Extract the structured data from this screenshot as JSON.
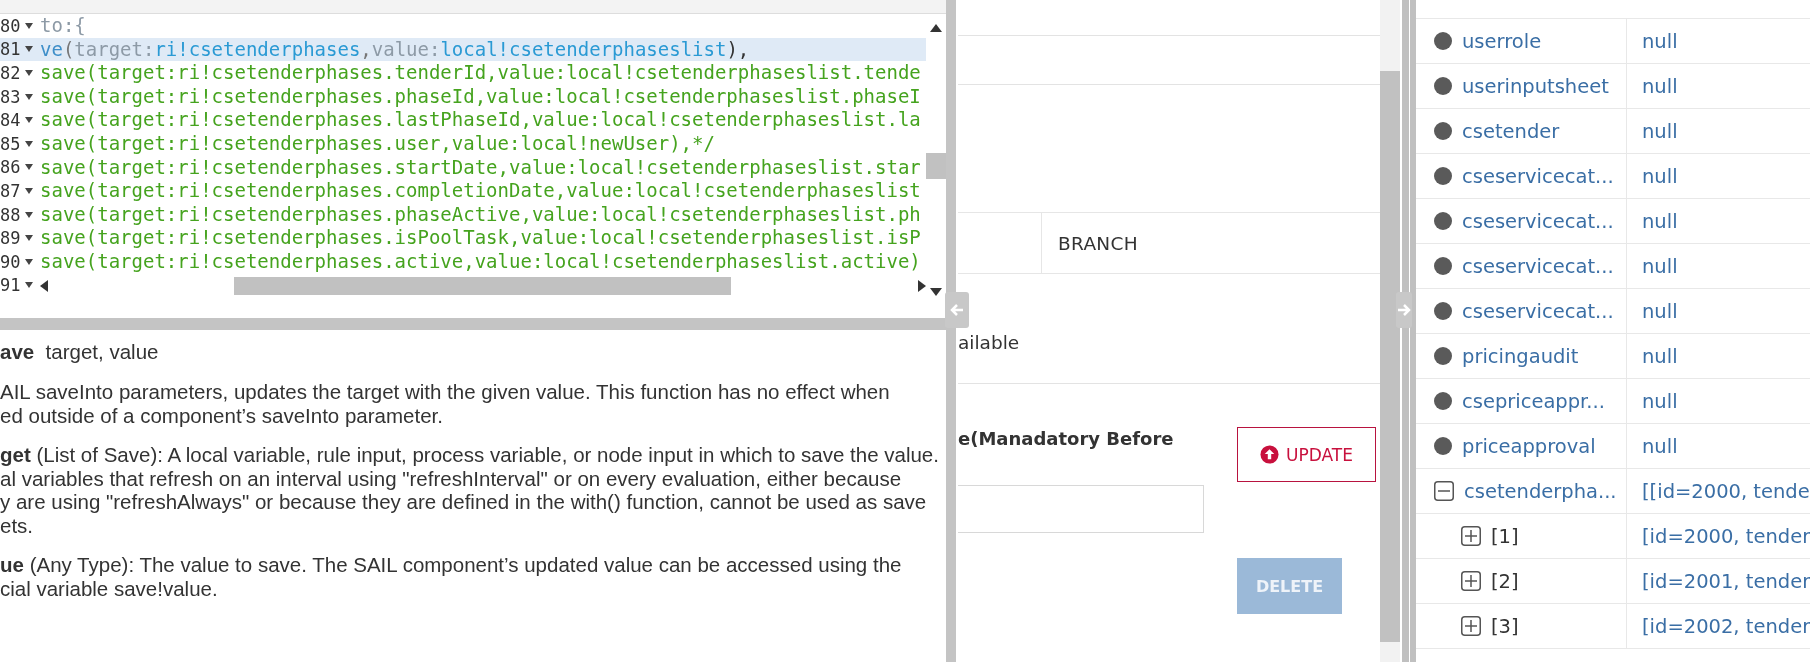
{
  "code_editor": {
    "lines": [
      {
        "number": "80",
        "active": false,
        "tokens": [
          {
            "kind": "keyword",
            "text": "to:{"
          }
        ]
      },
      {
        "number": "81",
        "active": true,
        "tokens": [
          {
            "kind": "func",
            "text": "ve"
          },
          {
            "kind": "punct",
            "text": "("
          },
          {
            "kind": "keyword",
            "text": "target:"
          },
          {
            "kind": "name",
            "text": "ri!csetenderphases"
          },
          {
            "kind": "punct",
            "text": ","
          },
          {
            "kind": "keyword",
            "text": "value:"
          },
          {
            "kind": "name",
            "text": "local!csetenderphaseslist"
          },
          {
            "kind": "plain",
            "text": "),"
          }
        ]
      },
      {
        "number": "82",
        "active": false,
        "tokens": [
          {
            "kind": "comment",
            "text": "save(target:ri!csetenderphases.tenderId,value:local!csetenderphaseslist.tende"
          }
        ]
      },
      {
        "number": "83",
        "active": false,
        "tokens": [
          {
            "kind": "comment",
            "text": "save(target:ri!csetenderphases.phaseId,value:local!csetenderphaseslist.phaseI"
          }
        ]
      },
      {
        "number": "84",
        "active": false,
        "tokens": [
          {
            "kind": "comment",
            "text": "save(target:ri!csetenderphases.lastPhaseId,value:local!csetenderphaseslist.la"
          }
        ]
      },
      {
        "number": "85",
        "active": false,
        "tokens": [
          {
            "kind": "comment",
            "text": "save(target:ri!csetenderphases.user,value:local!newUser),*/"
          }
        ]
      },
      {
        "number": "86",
        "active": false,
        "tokens": [
          {
            "kind": "comment",
            "text": "save(target:ri!csetenderphases.startDate,value:local!csetenderphaseslist.star"
          }
        ]
      },
      {
        "number": "87",
        "active": false,
        "tokens": [
          {
            "kind": "comment",
            "text": "save(target:ri!csetenderphases.completionDate,value:local!csetenderphaseslist"
          }
        ]
      },
      {
        "number": "88",
        "active": false,
        "tokens": [
          {
            "kind": "comment",
            "text": "save(target:ri!csetenderphases.phaseActive,value:local!csetenderphaseslist.ph"
          }
        ]
      },
      {
        "number": "89",
        "active": false,
        "tokens": [
          {
            "kind": "comment",
            "text": "save(target:ri!csetenderphases.isPoolTask,value:local!csetenderphaseslist.isP"
          }
        ]
      },
      {
        "number": "90",
        "active": false,
        "tokens": [
          {
            "kind": "comment",
            "text": "save(target:ri!csetenderphases.active,value:local!csetenderphaseslist.active)"
          }
        ]
      },
      {
        "number": "91",
        "active": false
      }
    ]
  },
  "help": {
    "signature": "**ave**  target, value",
    "paragraphs": [
      {
        "lines": [
          "AIL saveInto parameters, updates the target with the given value. This function has no effect when",
          "ed outside of a component’s saveInto parameter."
        ]
      },
      {
        "lines": [
          "**get** (List of Save): A local variable, rule input, process variable, or node input in which to save the value.",
          "al variables that refresh on an interval using \"refreshInterval\" or on every evaluation, either because",
          "y are using \"refreshAlways\" or because they are defined in the with() function, cannot be used as save",
          "ets."
        ]
      },
      {
        "lines": [
          "**ue** (Any Type): The value to save. The SAIL component’s updated value can be accessed using the",
          "cial variable save!value."
        ]
      }
    ]
  },
  "form": {
    "cell_value": "BRANCH",
    "availability_text": "ailable",
    "field_label": "e(Manadatory Before",
    "update_button": "UPDATE",
    "delete_button": {
      "label": "DELETE",
      "disabled": true
    }
  },
  "variables": [
    {
      "kind": "leaf",
      "name": "userrole",
      "value": "null"
    },
    {
      "kind": "leaf",
      "name": "userinputsheet",
      "value": "null"
    },
    {
      "kind": "leaf",
      "name": "csetender",
      "value": "null"
    },
    {
      "kind": "leaf",
      "name": "cseservicecat...",
      "value": "null"
    },
    {
      "kind": "leaf",
      "name": "cseservicecat...",
      "value": "null"
    },
    {
      "kind": "leaf",
      "name": "cseservicecat...",
      "value": "null"
    },
    {
      "kind": "leaf",
      "name": "cseservicecat...",
      "value": "null"
    },
    {
      "kind": "leaf",
      "name": "pricingaudit",
      "value": "null"
    },
    {
      "kind": "leaf",
      "name": "csepriceappr...",
      "value": "null"
    },
    {
      "kind": "leaf",
      "name": "priceapproval",
      "value": "null"
    },
    {
      "kind": "node",
      "name": "csetenderpha...",
      "value": "[[id=2000, tende",
      "expanded": true,
      "children": [
        {
          "kind": "node",
          "name": "[1]",
          "value": "[id=2000, tender",
          "expanded": false
        },
        {
          "kind": "node",
          "name": "[2]",
          "value": "[id=2001, tender",
          "expanded": false
        },
        {
          "kind": "node",
          "name": "[3]",
          "value": "[id=2002, tender",
          "expanded": false
        }
      ]
    }
  ]
}
